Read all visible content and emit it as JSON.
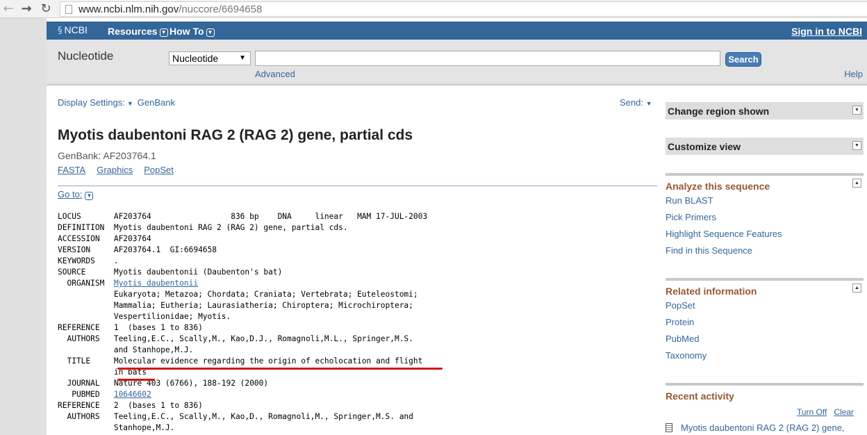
{
  "browser": {
    "url_host": "www.ncbi.nlm.nih.gov",
    "url_path": "/nuccore/6694658",
    "back_icon": "arrow-left",
    "forward_icon": "arrow-right",
    "reload_icon": "reload"
  },
  "header": {
    "logo": "NCBI",
    "menus": [
      "Resources",
      "How To"
    ],
    "signin": "Sign in to NCBI"
  },
  "search": {
    "db_title": "Nucleotide",
    "db_selected": "Nucleotide",
    "query": "",
    "button": "Search",
    "advanced": "Advanced",
    "help": "Help"
  },
  "record_header": {
    "display_settings": "Display Settings:",
    "format": "GenBank",
    "send": "Send:",
    "title": "Myotis daubentoni RAG 2 (RAG 2) gene, partial cds",
    "genbank_id": "GenBank: AF203764.1",
    "links": [
      "FASTA",
      "Graphics",
      "PopSet"
    ],
    "goto": "Go to:"
  },
  "record": {
    "lines": [
      [
        "LOCUS       ",
        "AF203764                 836 bp    DNA     linear   MAM 17-JUL-2003"
      ],
      [
        "DEFINITION  ",
        "Myotis daubentoni RAG 2 (RAG 2) gene, partial cds."
      ],
      [
        "ACCESSION   ",
        "AF203764"
      ],
      [
        "VERSION     ",
        "AF203764.1  GI:6694658"
      ],
      [
        "KEYWORDS    ",
        "."
      ],
      [
        "SOURCE      ",
        "Myotis daubentonii (Daubenton's bat)"
      ],
      [
        "  ORGANISM  ",
        "Myotis daubentonii"
      ],
      [
        "            ",
        "Eukaryota; Metazoa; Chordata; Craniata; Vertebrata; Euteleostomi;"
      ],
      [
        "            ",
        "Mammalia; Eutheria; Laurasiatheria; Chiroptera; Microchiroptera;"
      ],
      [
        "            ",
        "Vespertilionidae; Myotis."
      ],
      [
        "REFERENCE   ",
        "1  (bases 1 to 836)"
      ],
      [
        "  AUTHORS   ",
        "Teeling,E.C., Scally,M., Kao,D.J., Romagnoli,M.L., Springer,M.S."
      ],
      [
        "            ",
        "and Stanhope,M.J."
      ],
      [
        "  TITLE     ",
        "Molecular evidence regarding the origin of echolocation and flight"
      ],
      [
        "            ",
        "in bats"
      ],
      [
        "  JOURNAL   ",
        "Nature 403 (6766), 188-192 (2000)"
      ],
      [
        "   PUBMED   ",
        "10646602"
      ],
      [
        "REFERENCE   ",
        "2  (bases 1 to 836)"
      ],
      [
        "  AUTHORS   ",
        "Teeling,E.C., Scally,M., Kao,D., Romagnoli,M., Springer,M.S. and"
      ],
      [
        "            ",
        "Stanhope,M.J."
      ]
    ]
  },
  "sidebar": {
    "change_region": "Change region shown",
    "customize_view": "Customize view",
    "analyze": {
      "title": "Analyze this sequence",
      "items": [
        "Run BLAST",
        "Pick Primers",
        "Highlight Sequence Features",
        "Find in this Sequence"
      ]
    },
    "related": {
      "title": "Related information",
      "items": [
        "PopSet",
        "Protein",
        "PubMed",
        "Taxonomy"
      ]
    },
    "recent": {
      "title": "Recent activity",
      "turn_off": "Turn Off",
      "clear": "Clear",
      "item": "Myotis daubentoni RAG 2 (RAG 2) gene,"
    }
  },
  "colors": {
    "ncbi_blue": "#336699",
    "sidebar_heading": "#985735",
    "annotation_red": "#d01818"
  }
}
